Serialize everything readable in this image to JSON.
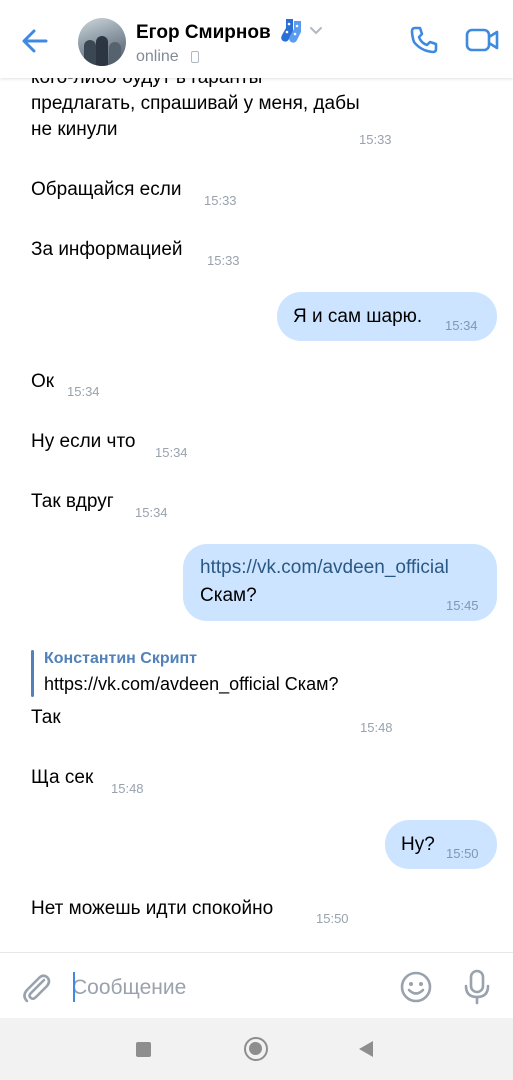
{
  "header": {
    "contact_name": "Егор Смирнов",
    "status": "online",
    "icons": {
      "back": "arrow-left-icon",
      "chevron": "chevron-down-icon",
      "call": "phone-icon",
      "video": "video-camera-icon",
      "emoji": "socks-emoji"
    }
  },
  "messages": [
    {
      "direction": "in",
      "text_line1": "кого-либо будут в гаранты",
      "text_line2": "предлагать, спрашивай у меня, дабы",
      "text_line3": "не кинули",
      "time": "15:33"
    },
    {
      "direction": "in",
      "text": "Обращайся если",
      "time": "15:33"
    },
    {
      "direction": "in",
      "text": "За информацией",
      "time": "15:33"
    },
    {
      "direction": "out",
      "text": "Я и сам шарю.",
      "time": "15:34"
    },
    {
      "direction": "in",
      "text": "Ок",
      "time": "15:34"
    },
    {
      "direction": "in",
      "text": "Ну если что",
      "time": "15:34"
    },
    {
      "direction": "in",
      "text": "Так вдруг",
      "time": "15:34"
    },
    {
      "direction": "out",
      "link": "https://vk.com/avdeen_official",
      "text": "Скам?",
      "time": "15:45"
    },
    {
      "direction": "in",
      "reply_author": "Константин Скрипт",
      "reply_text": "https://vk.com/avdeen_official Скам?",
      "text": "Так",
      "time": "15:48"
    },
    {
      "direction": "in",
      "text": "Ща сек",
      "time": "15:48"
    },
    {
      "direction": "out",
      "text": "Ну?",
      "time": "15:50"
    },
    {
      "direction": "in",
      "text": "Нет можешь идти спокойно",
      "time": "15:50"
    }
  ],
  "composer": {
    "placeholder": "Сообщение",
    "icons": {
      "attach": "paperclip-icon",
      "emoji": "smile-icon",
      "mic": "microphone-icon"
    }
  },
  "navbar": {
    "icons": {
      "recents": "square-icon",
      "home": "circle-icon",
      "back": "triangle-back-icon"
    }
  },
  "colors": {
    "accent": "#3f8ae0",
    "outgoing_bubble": "#cce4ff",
    "time_gray": "#99a2ad",
    "link": "#2a5885",
    "reply_author": "#5181b8"
  }
}
